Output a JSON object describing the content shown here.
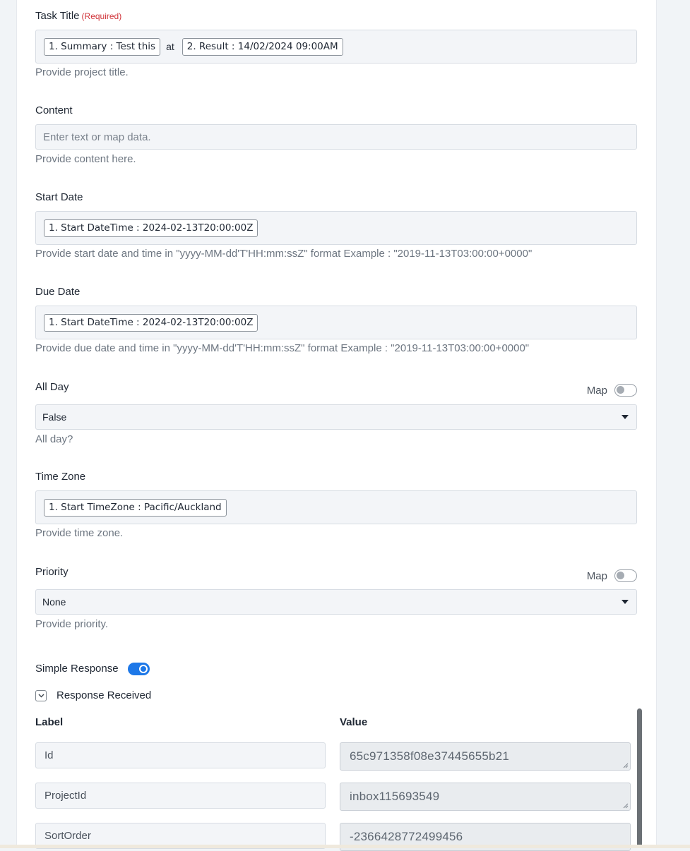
{
  "task_title": {
    "label": "Task Title",
    "required": "(Required)",
    "chip1": "1. Summary : Test this",
    "between": "at",
    "chip2": "2. Result : 14/02/2024 09:00AM",
    "help": "Provide project title."
  },
  "content": {
    "label": "Content",
    "placeholder": "Enter text or map data.",
    "help": "Provide content here."
  },
  "start_date": {
    "label": "Start Date",
    "chip": "1. Start DateTime : 2024-02-13T20:00:00Z",
    "help": "Provide start date and time in \"yyyy-MM-dd'T'HH:mm:ssZ\" format Example : \"2019-11-13T03:00:00+0000\""
  },
  "due_date": {
    "label": "Due Date",
    "chip": "1. Start DateTime : 2024-02-13T20:00:00Z",
    "help": "Provide due date and time in \"yyyy-MM-dd'T'HH:mm:ssZ\" format Example : \"2019-11-13T03:00:00+0000\""
  },
  "all_day": {
    "label": "All Day",
    "map_label": "Map",
    "value": "False",
    "help": "All day?"
  },
  "time_zone": {
    "label": "Time Zone",
    "chip": "1. Start TimeZone : Pacific/Auckland",
    "help": "Provide time zone."
  },
  "priority": {
    "label": "Priority",
    "map_label": "Map",
    "value": "None",
    "help": "Provide priority."
  },
  "simple_response": {
    "label": "Simple Response",
    "enabled": true
  },
  "response_received": {
    "label": "Response Received",
    "col_label": "Label",
    "col_value": "Value",
    "rows": [
      {
        "label": "Id",
        "value": "65c971358f08e37445655b21"
      },
      {
        "label": "ProjectId",
        "value": "inbox115693549"
      },
      {
        "label": "SortOrder",
        "value": "-2366428772499456"
      }
    ]
  },
  "colors": {
    "accent": "#1d78e8",
    "required": "#d0343a"
  }
}
